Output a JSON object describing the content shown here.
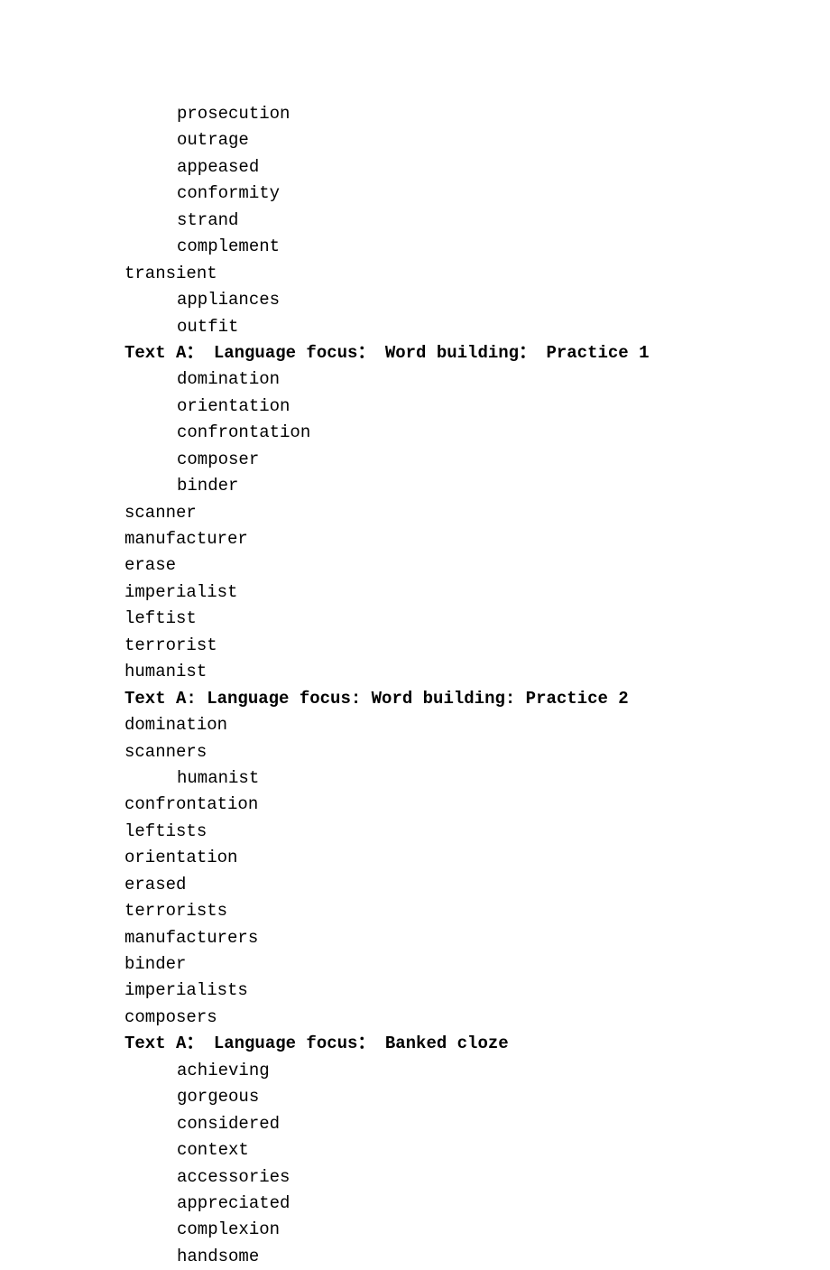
{
  "lines": [
    {
      "text": "prosecution",
      "indent": true,
      "bold": false
    },
    {
      "text": "outrage",
      "indent": true,
      "bold": false
    },
    {
      "text": "appeased",
      "indent": true,
      "bold": false
    },
    {
      "text": "conformity",
      "indent": true,
      "bold": false
    },
    {
      "text": "strand",
      "indent": true,
      "bold": false
    },
    {
      "text": "complement",
      "indent": true,
      "bold": false
    },
    {
      "text": "transient",
      "indent": false,
      "bold": false
    },
    {
      "text": "appliances",
      "indent": true,
      "bold": false
    },
    {
      "text": "outfit",
      "indent": true,
      "bold": false
    },
    {
      "text": "Text A： Language focus： Word building： Practice 1",
      "indent": false,
      "bold": true
    },
    {
      "text": "domination",
      "indent": true,
      "bold": false
    },
    {
      "text": "orientation",
      "indent": true,
      "bold": false
    },
    {
      "text": "confrontation",
      "indent": true,
      "bold": false
    },
    {
      "text": "composer",
      "indent": true,
      "bold": false
    },
    {
      "text": "binder",
      "indent": true,
      "bold": false
    },
    {
      "text": "scanner",
      "indent": false,
      "bold": false
    },
    {
      "text": "manufacturer",
      "indent": false,
      "bold": false
    },
    {
      "text": "erase",
      "indent": false,
      "bold": false
    },
    {
      "text": "imperialist",
      "indent": false,
      "bold": false
    },
    {
      "text": "leftist",
      "indent": false,
      "bold": false
    },
    {
      "text": "terrorist",
      "indent": false,
      "bold": false
    },
    {
      "text": "humanist",
      "indent": false,
      "bold": false
    },
    {
      "text": "Text A: Language focus: Word building: Practice 2",
      "indent": false,
      "bold": true
    },
    {
      "text": "domination",
      "indent": false,
      "bold": false
    },
    {
      "text": "scanners",
      "indent": false,
      "bold": false
    },
    {
      "text": "humanist",
      "indent": true,
      "bold": false
    },
    {
      "text": "confrontation",
      "indent": false,
      "bold": false
    },
    {
      "text": "leftists",
      "indent": false,
      "bold": false
    },
    {
      "text": "orientation",
      "indent": false,
      "bold": false
    },
    {
      "text": "erased",
      "indent": false,
      "bold": false
    },
    {
      "text": "terrorists",
      "indent": false,
      "bold": false
    },
    {
      "text": "manufacturers",
      "indent": false,
      "bold": false
    },
    {
      "text": "binder",
      "indent": false,
      "bold": false
    },
    {
      "text": "imperialists",
      "indent": false,
      "bold": false
    },
    {
      "text": "composers",
      "indent": false,
      "bold": false
    },
    {
      "text": "Text A： Language focus： Banked cloze",
      "indent": false,
      "bold": true
    },
    {
      "text": "achieving",
      "indent": true,
      "bold": false
    },
    {
      "text": "gorgeous",
      "indent": true,
      "bold": false
    },
    {
      "text": "considered",
      "indent": true,
      "bold": false
    },
    {
      "text": "context",
      "indent": true,
      "bold": false
    },
    {
      "text": "accessories",
      "indent": true,
      "bold": false
    },
    {
      "text": "appreciated",
      "indent": true,
      "bold": false
    },
    {
      "text": "complexion",
      "indent": true,
      "bold": false
    },
    {
      "text": "handsome",
      "indent": true,
      "bold": false
    }
  ]
}
